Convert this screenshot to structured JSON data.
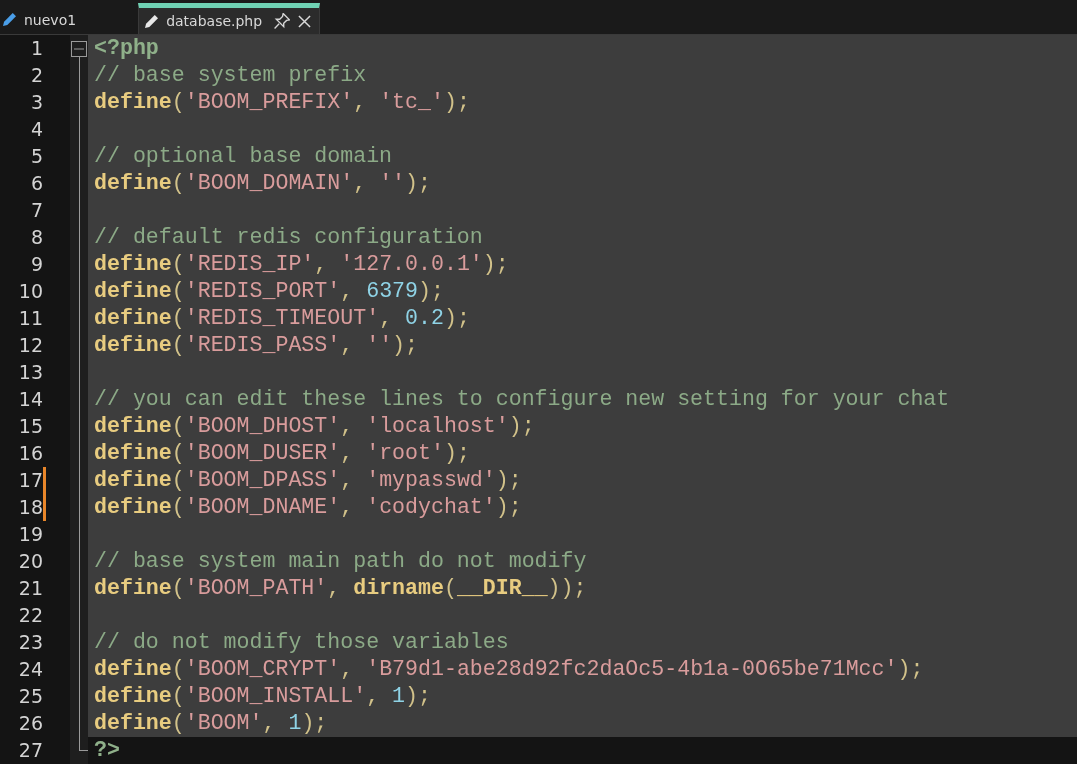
{
  "tabs": [
    {
      "label": "nuevo1",
      "selected": false
    },
    {
      "label": "database.php",
      "selected": true
    }
  ],
  "editor": {
    "lines": [
      {
        "number": "1",
        "modified": false,
        "highlighted": true,
        "tokens": [
          {
            "kind": "tag",
            "text": "<?php"
          }
        ]
      },
      {
        "number": "2",
        "modified": false,
        "highlighted": true,
        "tokens": [
          {
            "kind": "comment",
            "text": "// base system prefix"
          }
        ]
      },
      {
        "number": "3",
        "modified": false,
        "highlighted": true,
        "tokens": [
          {
            "kind": "func",
            "text": "define"
          },
          {
            "kind": "punct",
            "text": "("
          },
          {
            "kind": "string",
            "text": "'BOOM_PREFIX'"
          },
          {
            "kind": "punct",
            "text": ", "
          },
          {
            "kind": "string",
            "text": "'tc_'"
          },
          {
            "kind": "punct",
            "text": ");"
          }
        ]
      },
      {
        "number": "4",
        "modified": false,
        "highlighted": true
      },
      {
        "number": "5",
        "modified": false,
        "highlighted": true,
        "tokens": [
          {
            "kind": "comment",
            "text": "// optional base domain"
          }
        ]
      },
      {
        "number": "6",
        "modified": false,
        "highlighted": true,
        "tokens": [
          {
            "kind": "func",
            "text": "define"
          },
          {
            "kind": "punct",
            "text": "("
          },
          {
            "kind": "string",
            "text": "'BOOM_DOMAIN'"
          },
          {
            "kind": "punct",
            "text": ", "
          },
          {
            "kind": "string",
            "text": "''"
          },
          {
            "kind": "punct",
            "text": ");"
          }
        ]
      },
      {
        "number": "7",
        "modified": false,
        "highlighted": true
      },
      {
        "number": "8",
        "modified": false,
        "highlighted": true,
        "tokens": [
          {
            "kind": "comment",
            "text": "// default redis configuration"
          }
        ]
      },
      {
        "number": "9",
        "modified": false,
        "highlighted": true,
        "tokens": [
          {
            "kind": "func",
            "text": "define"
          },
          {
            "kind": "punct",
            "text": "("
          },
          {
            "kind": "string",
            "text": "'REDIS_IP'"
          },
          {
            "kind": "punct",
            "text": ", "
          },
          {
            "kind": "string",
            "text": "'127.0.0.1'"
          },
          {
            "kind": "punct",
            "text": ");"
          }
        ]
      },
      {
        "number": "10",
        "modified": false,
        "highlighted": true,
        "tokens": [
          {
            "kind": "func",
            "text": "define"
          },
          {
            "kind": "punct",
            "text": "("
          },
          {
            "kind": "string",
            "text": "'REDIS_PORT'"
          },
          {
            "kind": "punct",
            "text": ", "
          },
          {
            "kind": "number",
            "text": "6379"
          },
          {
            "kind": "punct",
            "text": ");"
          }
        ]
      },
      {
        "number": "11",
        "modified": false,
        "highlighted": true,
        "tokens": [
          {
            "kind": "func",
            "text": "define"
          },
          {
            "kind": "punct",
            "text": "("
          },
          {
            "kind": "string",
            "text": "'REDIS_TIMEOUT'"
          },
          {
            "kind": "punct",
            "text": ", "
          },
          {
            "kind": "number",
            "text": "0.2"
          },
          {
            "kind": "punct",
            "text": ");"
          }
        ]
      },
      {
        "number": "12",
        "modified": false,
        "highlighted": true,
        "tokens": [
          {
            "kind": "func",
            "text": "define"
          },
          {
            "kind": "punct",
            "text": "("
          },
          {
            "kind": "string",
            "text": "'REDIS_PASS'"
          },
          {
            "kind": "punct",
            "text": ", "
          },
          {
            "kind": "string",
            "text": "''"
          },
          {
            "kind": "punct",
            "text": ");"
          }
        ]
      },
      {
        "number": "13",
        "modified": false,
        "highlighted": true
      },
      {
        "number": "14",
        "modified": false,
        "highlighted": true,
        "tokens": [
          {
            "kind": "comment",
            "text": "// you can edit these lines to configure new setting for your chat"
          }
        ]
      },
      {
        "number": "15",
        "modified": false,
        "highlighted": true,
        "tokens": [
          {
            "kind": "func",
            "text": "define"
          },
          {
            "kind": "punct",
            "text": "("
          },
          {
            "kind": "string",
            "text": "'BOOM_DHOST'"
          },
          {
            "kind": "punct",
            "text": ", "
          },
          {
            "kind": "string",
            "text": "'localhost'"
          },
          {
            "kind": "punct",
            "text": ");"
          }
        ]
      },
      {
        "number": "16",
        "modified": false,
        "highlighted": true,
        "tokens": [
          {
            "kind": "func",
            "text": "define"
          },
          {
            "kind": "punct",
            "text": "("
          },
          {
            "kind": "string",
            "text": "'BOOM_DUSER'"
          },
          {
            "kind": "punct",
            "text": ", "
          },
          {
            "kind": "string",
            "text": "'root'"
          },
          {
            "kind": "punct",
            "text": ");"
          }
        ]
      },
      {
        "number": "17",
        "modified": true,
        "highlighted": true,
        "tokens": [
          {
            "kind": "func",
            "text": "define"
          },
          {
            "kind": "punct",
            "text": "("
          },
          {
            "kind": "string",
            "text": "'BOOM_DPASS'"
          },
          {
            "kind": "punct",
            "text": ", "
          },
          {
            "kind": "string",
            "text": "'mypasswd'"
          },
          {
            "kind": "punct",
            "text": ");"
          }
        ]
      },
      {
        "number": "18",
        "modified": true,
        "highlighted": true,
        "tokens": [
          {
            "kind": "func",
            "text": "define"
          },
          {
            "kind": "punct",
            "text": "("
          },
          {
            "kind": "string",
            "text": "'BOOM_DNAME'"
          },
          {
            "kind": "punct",
            "text": ", "
          },
          {
            "kind": "string",
            "text": "'codychat'"
          },
          {
            "kind": "punct",
            "text": ");"
          }
        ]
      },
      {
        "number": "19",
        "modified": false,
        "highlighted": true
      },
      {
        "number": "20",
        "modified": false,
        "highlighted": true,
        "tokens": [
          {
            "kind": "comment",
            "text": "// base system main path do not modify"
          }
        ]
      },
      {
        "number": "21",
        "modified": false,
        "highlighted": true,
        "tokens": [
          {
            "kind": "func",
            "text": "define"
          },
          {
            "kind": "punct",
            "text": "("
          },
          {
            "kind": "string",
            "text": "'BOOM_PATH'"
          },
          {
            "kind": "punct",
            "text": ", "
          },
          {
            "kind": "func",
            "text": "dirname"
          },
          {
            "kind": "punct",
            "text": "("
          },
          {
            "kind": "func",
            "text": "__DIR__"
          },
          {
            "kind": "punct",
            "text": "));"
          }
        ]
      },
      {
        "number": "22",
        "modified": false,
        "highlighted": true
      },
      {
        "number": "23",
        "modified": false,
        "highlighted": true,
        "tokens": [
          {
            "kind": "comment",
            "text": "// do not modify those variables"
          }
        ]
      },
      {
        "number": "24",
        "modified": false,
        "highlighted": true,
        "tokens": [
          {
            "kind": "func",
            "text": "define"
          },
          {
            "kind": "punct",
            "text": "("
          },
          {
            "kind": "string",
            "text": "'BOOM_CRYPT'"
          },
          {
            "kind": "punct",
            "text": ", "
          },
          {
            "kind": "string",
            "text": "'B79d1-abe28d92fc2daOc5-4b1a-0O65be71Mcc'"
          },
          {
            "kind": "punct",
            "text": ");"
          }
        ]
      },
      {
        "number": "25",
        "modified": false,
        "highlighted": true,
        "tokens": [
          {
            "kind": "func",
            "text": "define"
          },
          {
            "kind": "punct",
            "text": "("
          },
          {
            "kind": "string",
            "text": "'BOOM_INSTALL'"
          },
          {
            "kind": "punct",
            "text": ", "
          },
          {
            "kind": "number",
            "text": "1"
          },
          {
            "kind": "punct",
            "text": ");"
          }
        ]
      },
      {
        "number": "26",
        "modified": false,
        "highlighted": true,
        "tokens": [
          {
            "kind": "func",
            "text": "define"
          },
          {
            "kind": "punct",
            "text": "("
          },
          {
            "kind": "string",
            "text": "'BOOM'"
          },
          {
            "kind": "punct",
            "text": ", "
          },
          {
            "kind": "number",
            "text": "1"
          },
          {
            "kind": "punct",
            "text": ");"
          }
        ]
      },
      {
        "number": "27",
        "modified": false,
        "highlighted": false,
        "tokens": [
          {
            "kind": "tag",
            "text": "?>"
          }
        ]
      }
    ]
  }
}
